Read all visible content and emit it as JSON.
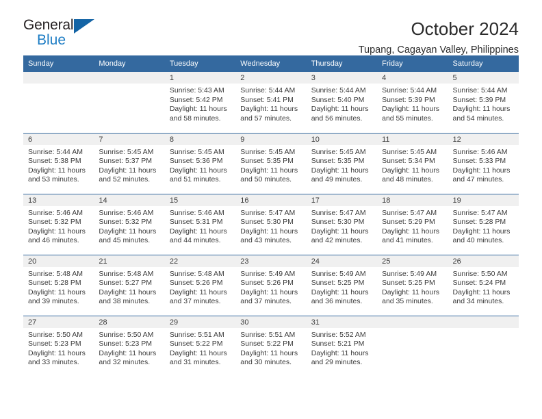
{
  "brand": {
    "name_top": "General",
    "name_bottom": "Blue",
    "color_blue": "#1c7cc4",
    "color_triangle": "#1464a5"
  },
  "header": {
    "title": "October 2024",
    "subtitle": "Tupang, Cagayan Valley, Philippines"
  },
  "theme": {
    "header_row_bg": "#34699f",
    "date_bar_bg": "#f0f0f0",
    "text_color": "#3a3a3a"
  },
  "labels": {
    "sunrise_prefix": "Sunrise:",
    "sunset_prefix": "Sunset:",
    "daylight_prefix": "Daylight:"
  },
  "weekdays": [
    "Sunday",
    "Monday",
    "Tuesday",
    "Wednesday",
    "Thursday",
    "Friday",
    "Saturday"
  ],
  "weeks": [
    [
      {
        "empty": true
      },
      {
        "empty": true
      },
      {
        "date": "1",
        "sunrise": "Sunrise: 5:43 AM",
        "sunset": "Sunset: 5:42 PM",
        "daylight": "Daylight: 11 hours and 58 minutes."
      },
      {
        "date": "2",
        "sunrise": "Sunrise: 5:44 AM",
        "sunset": "Sunset: 5:41 PM",
        "daylight": "Daylight: 11 hours and 57 minutes."
      },
      {
        "date": "3",
        "sunrise": "Sunrise: 5:44 AM",
        "sunset": "Sunset: 5:40 PM",
        "daylight": "Daylight: 11 hours and 56 minutes."
      },
      {
        "date": "4",
        "sunrise": "Sunrise: 5:44 AM",
        "sunset": "Sunset: 5:39 PM",
        "daylight": "Daylight: 11 hours and 55 minutes."
      },
      {
        "date": "5",
        "sunrise": "Sunrise: 5:44 AM",
        "sunset": "Sunset: 5:39 PM",
        "daylight": "Daylight: 11 hours and 54 minutes."
      }
    ],
    [
      {
        "date": "6",
        "sunrise": "Sunrise: 5:44 AM",
        "sunset": "Sunset: 5:38 PM",
        "daylight": "Daylight: 11 hours and 53 minutes."
      },
      {
        "date": "7",
        "sunrise": "Sunrise: 5:45 AM",
        "sunset": "Sunset: 5:37 PM",
        "daylight": "Daylight: 11 hours and 52 minutes."
      },
      {
        "date": "8",
        "sunrise": "Sunrise: 5:45 AM",
        "sunset": "Sunset: 5:36 PM",
        "daylight": "Daylight: 11 hours and 51 minutes."
      },
      {
        "date": "9",
        "sunrise": "Sunrise: 5:45 AM",
        "sunset": "Sunset: 5:35 PM",
        "daylight": "Daylight: 11 hours and 50 minutes."
      },
      {
        "date": "10",
        "sunrise": "Sunrise: 5:45 AM",
        "sunset": "Sunset: 5:35 PM",
        "daylight": "Daylight: 11 hours and 49 minutes."
      },
      {
        "date": "11",
        "sunrise": "Sunrise: 5:45 AM",
        "sunset": "Sunset: 5:34 PM",
        "daylight": "Daylight: 11 hours and 48 minutes."
      },
      {
        "date": "12",
        "sunrise": "Sunrise: 5:46 AM",
        "sunset": "Sunset: 5:33 PM",
        "daylight": "Daylight: 11 hours and 47 minutes."
      }
    ],
    [
      {
        "date": "13",
        "sunrise": "Sunrise: 5:46 AM",
        "sunset": "Sunset: 5:32 PM",
        "daylight": "Daylight: 11 hours and 46 minutes."
      },
      {
        "date": "14",
        "sunrise": "Sunrise: 5:46 AM",
        "sunset": "Sunset: 5:32 PM",
        "daylight": "Daylight: 11 hours and 45 minutes."
      },
      {
        "date": "15",
        "sunrise": "Sunrise: 5:46 AM",
        "sunset": "Sunset: 5:31 PM",
        "daylight": "Daylight: 11 hours and 44 minutes."
      },
      {
        "date": "16",
        "sunrise": "Sunrise: 5:47 AM",
        "sunset": "Sunset: 5:30 PM",
        "daylight": "Daylight: 11 hours and 43 minutes."
      },
      {
        "date": "17",
        "sunrise": "Sunrise: 5:47 AM",
        "sunset": "Sunset: 5:30 PM",
        "daylight": "Daylight: 11 hours and 42 minutes."
      },
      {
        "date": "18",
        "sunrise": "Sunrise: 5:47 AM",
        "sunset": "Sunset: 5:29 PM",
        "daylight": "Daylight: 11 hours and 41 minutes."
      },
      {
        "date": "19",
        "sunrise": "Sunrise: 5:47 AM",
        "sunset": "Sunset: 5:28 PM",
        "daylight": "Daylight: 11 hours and 40 minutes."
      }
    ],
    [
      {
        "date": "20",
        "sunrise": "Sunrise: 5:48 AM",
        "sunset": "Sunset: 5:28 PM",
        "daylight": "Daylight: 11 hours and 39 minutes."
      },
      {
        "date": "21",
        "sunrise": "Sunrise: 5:48 AM",
        "sunset": "Sunset: 5:27 PM",
        "daylight": "Daylight: 11 hours and 38 minutes."
      },
      {
        "date": "22",
        "sunrise": "Sunrise: 5:48 AM",
        "sunset": "Sunset: 5:26 PM",
        "daylight": "Daylight: 11 hours and 37 minutes."
      },
      {
        "date": "23",
        "sunrise": "Sunrise: 5:49 AM",
        "sunset": "Sunset: 5:26 PM",
        "daylight": "Daylight: 11 hours and 37 minutes."
      },
      {
        "date": "24",
        "sunrise": "Sunrise: 5:49 AM",
        "sunset": "Sunset: 5:25 PM",
        "daylight": "Daylight: 11 hours and 36 minutes."
      },
      {
        "date": "25",
        "sunrise": "Sunrise: 5:49 AM",
        "sunset": "Sunset: 5:25 PM",
        "daylight": "Daylight: 11 hours and 35 minutes."
      },
      {
        "date": "26",
        "sunrise": "Sunrise: 5:50 AM",
        "sunset": "Sunset: 5:24 PM",
        "daylight": "Daylight: 11 hours and 34 minutes."
      }
    ],
    [
      {
        "date": "27",
        "sunrise": "Sunrise: 5:50 AM",
        "sunset": "Sunset: 5:23 PM",
        "daylight": "Daylight: 11 hours and 33 minutes."
      },
      {
        "date": "28",
        "sunrise": "Sunrise: 5:50 AM",
        "sunset": "Sunset: 5:23 PM",
        "daylight": "Daylight: 11 hours and 32 minutes."
      },
      {
        "date": "29",
        "sunrise": "Sunrise: 5:51 AM",
        "sunset": "Sunset: 5:22 PM",
        "daylight": "Daylight: 11 hours and 31 minutes."
      },
      {
        "date": "30",
        "sunrise": "Sunrise: 5:51 AM",
        "sunset": "Sunset: 5:22 PM",
        "daylight": "Daylight: 11 hours and 30 minutes."
      },
      {
        "date": "31",
        "sunrise": "Sunrise: 5:52 AM",
        "sunset": "Sunset: 5:21 PM",
        "daylight": "Daylight: 11 hours and 29 minutes."
      },
      {
        "empty": true
      },
      {
        "empty": true
      }
    ]
  ]
}
